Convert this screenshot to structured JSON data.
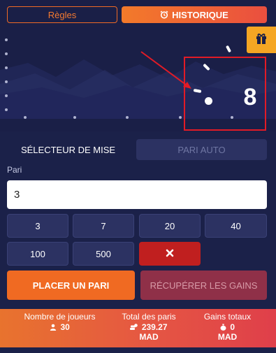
{
  "header": {
    "rules_label": "Règles",
    "history_label": "HISTORIQUE"
  },
  "game": {
    "multiplier": "8"
  },
  "bet_panel": {
    "tab_selector": "SÉLECTEUR DE MISE",
    "tab_auto": "PARI AUTO",
    "bet_label": "Pari",
    "bet_value": "3",
    "quick_bets": [
      "3",
      "7",
      "20",
      "40",
      "100",
      "500"
    ],
    "place_bet_label": "PLACER UN PARI",
    "cashout_label": "RÉCUPÉRER LES GAINS"
  },
  "stats": {
    "players_label": "Nombre de joueurs",
    "players_value": "30",
    "total_bets_label": "Total des paris",
    "total_bets_value": "239.27",
    "total_bets_currency": "MAD",
    "total_wins_label": "Gains totaux",
    "total_wins_value": "0",
    "total_wins_currency": "MAD"
  },
  "colors": {
    "accent": "#f06a22",
    "highlight": "#e21b26",
    "background": "#1b2149"
  },
  "icons": {
    "history": "alarm-clock-icon",
    "gift": "gift-icon",
    "clear": "close-icon",
    "players": "user-icon",
    "bets": "coins-icon",
    "wins": "money-bag-icon"
  }
}
